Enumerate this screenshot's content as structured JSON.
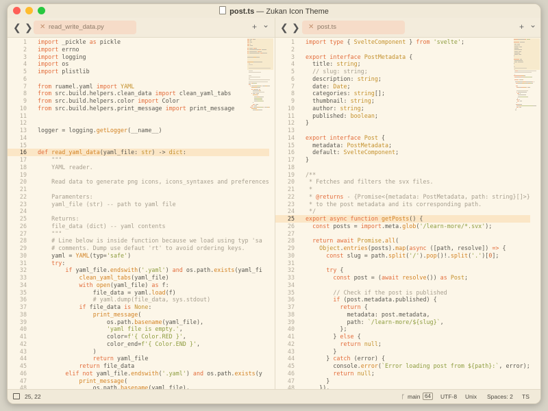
{
  "window": {
    "title_file": "post.ts",
    "title_rest": " — Zukan Icon Theme",
    "lights": {
      "close": "#fe5f57",
      "minimize": "#febc2e",
      "zoom": "#28c840"
    }
  },
  "nav": {
    "back": "❮",
    "forward": "❯"
  },
  "controls": {
    "add": "+",
    "menu": "⌄"
  },
  "left_tab": {
    "label": "read_write_data.py",
    "close": "✕"
  },
  "right_tab": {
    "label": "post.ts",
    "close": "✕"
  },
  "left_code": {
    "highlight_line": 16,
    "lines": [
      [
        [
          "kw",
          "import "
        ],
        [
          "txt",
          "_pickle "
        ],
        [
          "kw",
          "as "
        ],
        [
          "txt",
          "pickle"
        ]
      ],
      [
        [
          "kw",
          "import "
        ],
        [
          "txt",
          "errno"
        ]
      ],
      [
        [
          "kw",
          "import "
        ],
        [
          "txt",
          "logging"
        ]
      ],
      [
        [
          "kw",
          "import "
        ],
        [
          "txt",
          "os"
        ]
      ],
      [
        [
          "kw",
          "import "
        ],
        [
          "txt",
          "plistlib"
        ]
      ],
      [],
      [
        [
          "kw",
          "from "
        ],
        [
          "txt",
          "ruamel.yaml "
        ],
        [
          "kw",
          "import "
        ],
        [
          "ty",
          "YAML"
        ]
      ],
      [
        [
          "kw",
          "from "
        ],
        [
          "txt",
          "src.build.helpers.clean_data "
        ],
        [
          "kw",
          "import "
        ],
        [
          "txt",
          "clean_yaml_tabs"
        ]
      ],
      [
        [
          "kw",
          "from "
        ],
        [
          "txt",
          "src.build.helpers.color "
        ],
        [
          "kw",
          "import "
        ],
        [
          "txt",
          "Color"
        ]
      ],
      [
        [
          "kw",
          "from "
        ],
        [
          "txt",
          "src.build.helpers.print_message "
        ],
        [
          "kw",
          "import "
        ],
        [
          "txt",
          "print_message"
        ]
      ],
      [],
      [],
      [
        [
          "txt",
          "logger = logging."
        ],
        [
          "fn",
          "getLogger"
        ],
        [
          "txt",
          "(__name__)"
        ]
      ],
      [],
      [],
      [
        [
          "kw",
          "def "
        ],
        [
          "fn",
          "read_yaml_data"
        ],
        [
          "txt",
          "(yaml_file: "
        ],
        [
          "ty",
          "str"
        ],
        [
          "txt",
          ") -> "
        ],
        [
          "ty",
          "dict"
        ],
        [
          "txt",
          ":"
        ]
      ],
      [
        [
          "cm",
          "    \"\"\""
        ]
      ],
      [
        [
          "cm",
          "    YAML reader."
        ]
      ],
      [],
      [
        [
          "cm",
          "    Read data to generate png icons, icons_syntaxes and preferences"
        ]
      ],
      [],
      [
        [
          "cm",
          "    Paramenters:"
        ]
      ],
      [
        [
          "cm",
          "    yaml_file (str) -- path to yaml file"
        ]
      ],
      [],
      [
        [
          "cm",
          "    Returns:"
        ]
      ],
      [
        [
          "cm",
          "    file_data (dict) -- yaml contents"
        ]
      ],
      [
        [
          "cm",
          "    \"\"\""
        ]
      ],
      [
        [
          "cm",
          "    # Line below is inside function because we load using typ 'sa"
        ]
      ],
      [
        [
          "cm",
          "    # comments. Dump use defaut 'rt' to avoid ordering keys."
        ]
      ],
      [
        [
          "txt",
          "    yaml = "
        ],
        [
          "fn",
          "YAML"
        ],
        [
          "txt",
          "(typ="
        ],
        [
          "str",
          "'safe'"
        ],
        [
          "txt",
          ")"
        ]
      ],
      [
        [
          "kw",
          "    try"
        ],
        [
          "txt",
          ":"
        ]
      ],
      [
        [
          "kw",
          "        if "
        ],
        [
          "txt",
          "yaml_file."
        ],
        [
          "fn",
          "endswith"
        ],
        [
          "txt",
          "("
        ],
        [
          "str",
          "'.yaml'"
        ],
        [
          "txt",
          ") "
        ],
        [
          "kw",
          "and "
        ],
        [
          "txt",
          "os.path."
        ],
        [
          "fn",
          "exists"
        ],
        [
          "txt",
          "(yaml_fi"
        ]
      ],
      [
        [
          "txt",
          "            "
        ],
        [
          "fn",
          "clean_yaml_tabs"
        ],
        [
          "txt",
          "(yaml_file)"
        ]
      ],
      [
        [
          "kw",
          "            with "
        ],
        [
          "fn",
          "open"
        ],
        [
          "txt",
          "(yaml_file) "
        ],
        [
          "kw",
          "as "
        ],
        [
          "txt",
          "f:"
        ]
      ],
      [
        [
          "txt",
          "                file_data = yaml."
        ],
        [
          "fn",
          "load"
        ],
        [
          "txt",
          "(f)"
        ]
      ],
      [
        [
          "cm",
          "                # yaml.dump(file_data, sys.stdout)"
        ]
      ],
      [
        [
          "kw",
          "            if "
        ],
        [
          "txt",
          "file_data "
        ],
        [
          "kw",
          "is "
        ],
        [
          "ty",
          "None"
        ],
        [
          "txt",
          ":"
        ]
      ],
      [
        [
          "txt",
          "                "
        ],
        [
          "fn",
          "print_message"
        ],
        [
          "txt",
          "("
        ]
      ],
      [
        [
          "txt",
          "                    os.path."
        ],
        [
          "fn",
          "basename"
        ],
        [
          "txt",
          "(yaml_file),"
        ]
      ],
      [
        [
          "str",
          "                    'yaml file is empty.'"
        ],
        [
          "txt",
          ","
        ]
      ],
      [
        [
          "txt",
          "                    color="
        ],
        [
          "str",
          "f'{ Color.RED }'"
        ],
        [
          "txt",
          ","
        ]
      ],
      [
        [
          "txt",
          "                    color_end="
        ],
        [
          "str",
          "f'{ Color.END }'"
        ],
        [
          "txt",
          ","
        ]
      ],
      [
        [
          "txt",
          "                )"
        ]
      ],
      [
        [
          "kw",
          "                return "
        ],
        [
          "txt",
          "yaml_file"
        ]
      ],
      [
        [
          "kw",
          "            return "
        ],
        [
          "txt",
          "file_data"
        ]
      ],
      [
        [
          "kw",
          "        elif not "
        ],
        [
          "txt",
          "yaml_file."
        ],
        [
          "fn",
          "endswith"
        ],
        [
          "txt",
          "("
        ],
        [
          "str",
          "'.yaml'"
        ],
        [
          "txt",
          ") "
        ],
        [
          "kw",
          "and "
        ],
        [
          "txt",
          "os.path."
        ],
        [
          "fn",
          "exists"
        ],
        [
          "txt",
          "(y"
        ]
      ],
      [
        [
          "txt",
          "            "
        ],
        [
          "fn",
          "print_message"
        ],
        [
          "txt",
          "("
        ]
      ],
      [
        [
          "txt",
          "                os.path."
        ],
        [
          "fn",
          "basename"
        ],
        [
          "txt",
          "(yaml_file),"
        ]
      ]
    ]
  },
  "right_code": {
    "highlight_line": 25,
    "lines": [
      [
        [
          "kw",
          "import type "
        ],
        [
          "txt",
          "{ "
        ],
        [
          "ty",
          "SvelteComponent"
        ],
        [
          "txt",
          " } "
        ],
        [
          "kw",
          "from "
        ],
        [
          "str",
          "'svelte'"
        ],
        [
          "txt",
          ";"
        ]
      ],
      [],
      [
        [
          "kw",
          "export interface "
        ],
        [
          "ty",
          "PostMetadata"
        ],
        [
          "txt",
          " {"
        ]
      ],
      [
        [
          "txt",
          "  title: "
        ],
        [
          "ty",
          "string"
        ],
        [
          "txt",
          ";"
        ]
      ],
      [
        [
          "cm",
          "  // slug: string;"
        ]
      ],
      [
        [
          "txt",
          "  description: "
        ],
        [
          "ty",
          "string"
        ],
        [
          "txt",
          ";"
        ]
      ],
      [
        [
          "txt",
          "  date: "
        ],
        [
          "ty",
          "Date"
        ],
        [
          "txt",
          ";"
        ]
      ],
      [
        [
          "txt",
          "  categories: "
        ],
        [
          "ty",
          "string"
        ],
        [
          "txt",
          "[];"
        ]
      ],
      [
        [
          "txt",
          "  thumbnail: "
        ],
        [
          "ty",
          "string"
        ],
        [
          "txt",
          ";"
        ]
      ],
      [
        [
          "txt",
          "  author: "
        ],
        [
          "ty",
          "string"
        ],
        [
          "txt",
          ";"
        ]
      ],
      [
        [
          "txt",
          "  published: "
        ],
        [
          "ty",
          "boolean"
        ],
        [
          "txt",
          ";"
        ]
      ],
      [
        [
          "txt",
          "}"
        ]
      ],
      [],
      [
        [
          "kw",
          "export interface "
        ],
        [
          "ty",
          "Post"
        ],
        [
          "txt",
          " {"
        ]
      ],
      [
        [
          "txt",
          "  metadata: "
        ],
        [
          "ty",
          "PostMetadata"
        ],
        [
          "txt",
          ";"
        ]
      ],
      [
        [
          "txt",
          "  default: "
        ],
        [
          "ty",
          "SvelteComponent"
        ],
        [
          "txt",
          ";"
        ]
      ],
      [
        [
          "txt",
          "}"
        ]
      ],
      [],
      [
        [
          "cm",
          "/**"
        ]
      ],
      [
        [
          "cm",
          " * Fetches and filters the svx files."
        ]
      ],
      [
        [
          "cm",
          " *"
        ]
      ],
      [
        [
          "cm",
          " * "
        ],
        [
          "kw",
          "@returns "
        ],
        [
          "cm",
          "- {Promise<{metadata: PostMetadata, path: string}[]>}"
        ]
      ],
      [
        [
          "cm",
          " * to the post metadata and its corresponding path."
        ]
      ],
      [
        [
          "cm",
          " */"
        ]
      ],
      [
        [
          "kw",
          "export async function "
        ],
        [
          "fn",
          "getPosts"
        ],
        [
          "txt",
          "() {"
        ]
      ],
      [
        [
          "kw",
          "  const "
        ],
        [
          "txt",
          "posts = "
        ],
        [
          "kw",
          "import"
        ],
        [
          "txt",
          ".meta."
        ],
        [
          "fn",
          "glob"
        ],
        [
          "txt",
          "("
        ],
        [
          "str",
          "'/learn-more/*.svx'"
        ],
        [
          "txt",
          ");"
        ]
      ],
      [],
      [
        [
          "kw",
          "  return await "
        ],
        [
          "ty",
          "Promise"
        ],
        [
          "txt",
          "."
        ],
        [
          "fn",
          "all"
        ],
        [
          "txt",
          "("
        ]
      ],
      [
        [
          "txt",
          "    "
        ],
        [
          "ty",
          "Object"
        ],
        [
          "txt",
          "."
        ],
        [
          "fn",
          "entries"
        ],
        [
          "txt",
          "(posts)."
        ],
        [
          "fn",
          "map"
        ],
        [
          "txt",
          "("
        ],
        [
          "kw",
          "async "
        ],
        [
          "txt",
          "([path, resolve]) "
        ],
        [
          "kw",
          "=> "
        ],
        [
          "txt",
          "{"
        ]
      ],
      [
        [
          "kw",
          "      const "
        ],
        [
          "txt",
          "slug = path."
        ],
        [
          "fn",
          "split"
        ],
        [
          "txt",
          "("
        ],
        [
          "str",
          "'/'"
        ],
        [
          "txt",
          ")."
        ],
        [
          "fn",
          "pop"
        ],
        [
          "txt",
          "()!."
        ],
        [
          "fn",
          "split"
        ],
        [
          "txt",
          "("
        ],
        [
          "str",
          "'.'"
        ],
        [
          "txt",
          ")["
        ],
        [
          "nm",
          "0"
        ],
        [
          "txt",
          "];"
        ]
      ],
      [],
      [
        [
          "kw",
          "      try "
        ],
        [
          "txt",
          "{"
        ]
      ],
      [
        [
          "kw",
          "        const "
        ],
        [
          "txt",
          "post = ("
        ],
        [
          "kw",
          "await "
        ],
        [
          "fn",
          "resolve"
        ],
        [
          "txt",
          "()) "
        ],
        [
          "kw",
          "as "
        ],
        [
          "ty",
          "Post"
        ],
        [
          "txt",
          ";"
        ]
      ],
      [],
      [
        [
          "cm",
          "        // Check if the post is published"
        ]
      ],
      [
        [
          "kw",
          "        if "
        ],
        [
          "txt",
          "(post.metadata.published) {"
        ]
      ],
      [
        [
          "kw",
          "          return "
        ],
        [
          "txt",
          "{"
        ]
      ],
      [
        [
          "txt",
          "            metadata: post.metadata,"
        ]
      ],
      [
        [
          "txt",
          "            path: "
        ],
        [
          "str",
          "`/learn-more/${slug}`"
        ],
        [
          "txt",
          ","
        ]
      ],
      [
        [
          "txt",
          "          };"
        ]
      ],
      [
        [
          "txt",
          "        } "
        ],
        [
          "kw",
          "else "
        ],
        [
          "txt",
          "{"
        ]
      ],
      [
        [
          "kw",
          "          return "
        ],
        [
          "ty",
          "null"
        ],
        [
          "txt",
          ";"
        ]
      ],
      [
        [
          "txt",
          "        }"
        ]
      ],
      [
        [
          "txt",
          "      } "
        ],
        [
          "kw",
          "catch "
        ],
        [
          "txt",
          "(error) {"
        ]
      ],
      [
        [
          "txt",
          "        console."
        ],
        [
          "fn",
          "error"
        ],
        [
          "txt",
          "("
        ],
        [
          "str",
          "`Error loading post from ${path}:`"
        ],
        [
          "txt",
          ", error);"
        ]
      ],
      [
        [
          "kw",
          "        return "
        ],
        [
          "ty",
          "null"
        ],
        [
          "txt",
          ";"
        ]
      ],
      [
        [
          "txt",
          "      }"
        ]
      ],
      [
        [
          "txt",
          "    }),"
        ]
      ]
    ]
  },
  "status": {
    "cursor": "25, 22",
    "branch": "main",
    "changes": "64",
    "encoding": "UTF-8",
    "line_endings": "Unix",
    "indent": "Spaces: 2",
    "syntax": "TS"
  }
}
